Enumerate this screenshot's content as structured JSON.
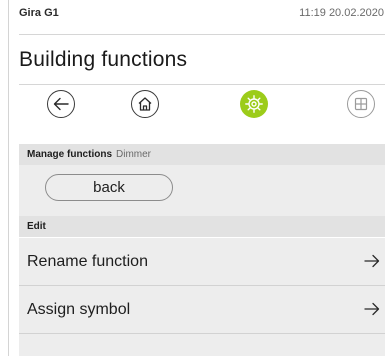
{
  "status": {
    "device_name": "Gira G1",
    "time_date": "11:19 20.02.2020"
  },
  "page": {
    "title": "Building functions"
  },
  "navbar": {
    "back_icon": "arrow-left-icon",
    "home_icon": "house-icon",
    "settings_icon": "gear-icon",
    "settings_active_color": "#9ccc1a",
    "grid_icon": "grid-icon"
  },
  "manage_section": {
    "title": "Manage functions",
    "subtitle": "Dimmer"
  },
  "back_button": {
    "label": "back"
  },
  "edit_section": {
    "title": "Edit",
    "items": [
      {
        "label": "Rename function",
        "icon": "arrow-right-icon"
      },
      {
        "label": "Assign symbol",
        "icon": "arrow-right-icon"
      }
    ]
  }
}
